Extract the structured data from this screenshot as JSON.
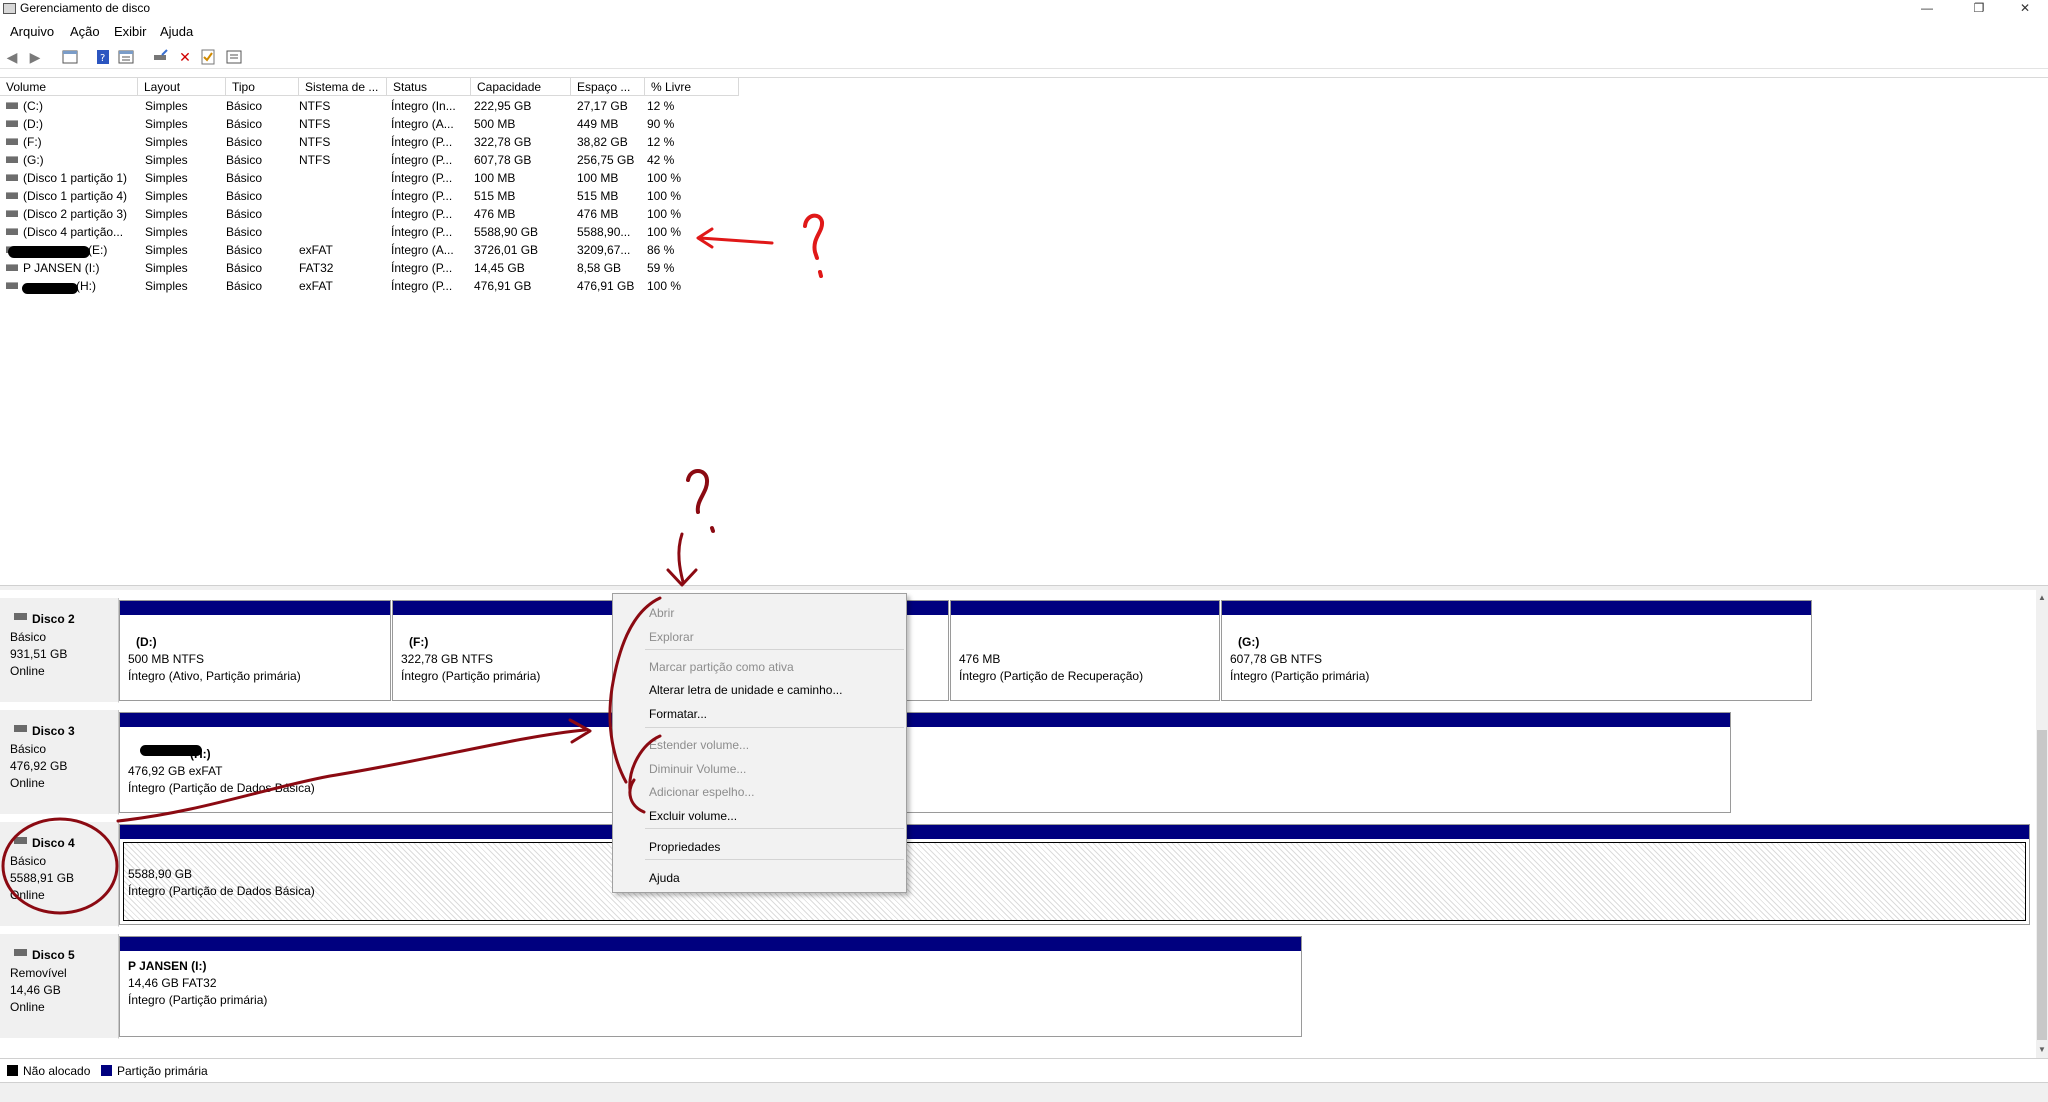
{
  "window": {
    "title": "Gerenciamento de disco",
    "minimize": "—",
    "restore": "❐",
    "close": "✕"
  },
  "menu": [
    "Arquivo",
    "Ação",
    "Exibir",
    "Ajuda"
  ],
  "columns": [
    "Volume",
    "Layout",
    "Tipo",
    "Sistema de ...",
    "Status",
    "Capacidade",
    "Espaço ...",
    "% Livre"
  ],
  "volumes": [
    {
      "volume": "(C:)",
      "layout": "Simples",
      "tipo": "Básico",
      "fs": "NTFS",
      "status": "Íntegro (In...",
      "cap": "222,95 GB",
      "free": "27,17 GB",
      "pct": "12 %"
    },
    {
      "volume": "(D:)",
      "layout": "Simples",
      "tipo": "Básico",
      "fs": "NTFS",
      "status": "Íntegro (A...",
      "cap": "500 MB",
      "free": "449 MB",
      "pct": "90 %"
    },
    {
      "volume": "(F:)",
      "layout": "Simples",
      "tipo": "Básico",
      "fs": "NTFS",
      "status": "Íntegro (P...",
      "cap": "322,78 GB",
      "free": "38,82 GB",
      "pct": "12 %"
    },
    {
      "volume": "(G:)",
      "layout": "Simples",
      "tipo": "Básico",
      "fs": "NTFS",
      "status": "Íntegro (P...",
      "cap": "607,78 GB",
      "free": "256,75 GB",
      "pct": "42 %"
    },
    {
      "volume": "(Disco 1 partição 1)",
      "layout": "Simples",
      "tipo": "Básico",
      "fs": "",
      "status": "Íntegro (P...",
      "cap": "100 MB",
      "free": "100 MB",
      "pct": "100 %"
    },
    {
      "volume": "(Disco 1 partição 4)",
      "layout": "Simples",
      "tipo": "Básico",
      "fs": "",
      "status": "Íntegro (P...",
      "cap": "515 MB",
      "free": "515 MB",
      "pct": "100 %"
    },
    {
      "volume": "(Disco 2 partição 3)",
      "layout": "Simples",
      "tipo": "Básico",
      "fs": "",
      "status": "Íntegro (P...",
      "cap": "476 MB",
      "free": "476 MB",
      "pct": "100 %"
    },
    {
      "volume": "(Disco 4 partição...",
      "layout": "Simples",
      "tipo": "Básico",
      "fs": "",
      "status": "Íntegro (P...",
      "cap": "5588,90 GB",
      "free": "5588,90...",
      "pct": "100 %"
    },
    {
      "volume": "(E:)",
      "layout": "Simples",
      "tipo": "Básico",
      "fs": "exFAT",
      "status": "Íntegro (A...",
      "cap": "3726,01 GB",
      "free": "3209,67...",
      "pct": "86 %"
    },
    {
      "volume": "P JANSEN (I:)",
      "layout": "Simples",
      "tipo": "Básico",
      "fs": "FAT32",
      "status": "Íntegro (P...",
      "cap": "14,45 GB",
      "free": "8,58 GB",
      "pct": "59 %"
    },
    {
      "volume": "(H:)",
      "layout": "Simples",
      "tipo": "Básico",
      "fs": "exFAT",
      "status": "Íntegro (P...",
      "cap": "476,91 GB",
      "free": "476,91 GB",
      "pct": "100 %"
    }
  ],
  "disks": [
    {
      "name": "Disco 2",
      "type": "Básico",
      "size": "931,51 GB",
      "state": "Online",
      "partitions": [
        {
          "head": "(D:)",
          "size": "500 MB NTFS",
          "status": "Íntegro (Ativo, Partição primária)"
        },
        {
          "head": "(F:)",
          "size": "322,78 GB NTFS",
          "status": "Íntegro (Partição primária)"
        },
        {
          "head": "",
          "size": "476 MB",
          "status": "Íntegro (Partição de Recuperação)"
        },
        {
          "head": "(G:)",
          "size": "607,78 GB NTFS",
          "status": "Íntegro (Partição primária)"
        }
      ]
    },
    {
      "name": "Disco 3",
      "type": "Básico",
      "size": "476,92 GB",
      "state": "Online",
      "partitions": [
        {
          "head": "(H:)",
          "size": "476,92 GB exFAT",
          "status": "Íntegro (Partição de Dados Básica)"
        }
      ]
    },
    {
      "name": "Disco 4",
      "type": "Básico",
      "size": "5588,91 GB",
      "state": "Online",
      "partitions": [
        {
          "head": "",
          "size": "5588,90 GB",
          "status": "Íntegro (Partição de Dados Básica)"
        }
      ]
    },
    {
      "name": "Disco 5",
      "type": "Removível",
      "size": "14,46 GB",
      "state": "Online",
      "partitions": [
        {
          "head": "P JANSEN  (I:)",
          "size": "14,46 GB FAT32",
          "status": "Íntegro (Partição primária)"
        }
      ]
    }
  ],
  "context_menu": {
    "abrir": "Abrir",
    "explorar": "Explorar",
    "marcar": "Marcar partição como ativa",
    "alterar": "Alterar letra de unidade e caminho...",
    "formatar": "Formatar...",
    "estender": "Estender volume...",
    "diminuir": "Diminuir Volume...",
    "adicionar": "Adicionar espelho...",
    "excluir": "Excluir volume...",
    "propriedades": "Propriedades",
    "ajuda": "Ajuda"
  },
  "legend": {
    "unallocated": "Não alocado",
    "primary": "Partição primária",
    "unallocated_color": "#000000",
    "primary_color": "#00007f"
  },
  "annotation_color": "#cc1111"
}
